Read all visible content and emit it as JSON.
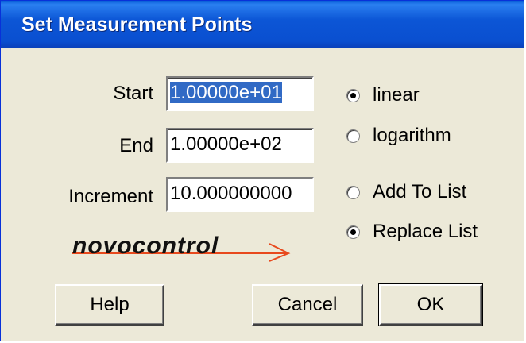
{
  "window": {
    "title": "Set Measurement Points"
  },
  "fields": {
    "start": {
      "label": "Start",
      "value": "1.00000e+01"
    },
    "end": {
      "label": "End",
      "value": "1.00000e+02"
    },
    "increment": {
      "label": "Increment",
      "value": "10.000000000"
    }
  },
  "scale_options": {
    "linear": {
      "label": "linear",
      "selected": true
    },
    "logarithm": {
      "label": "logarithm",
      "selected": false
    }
  },
  "list_options": {
    "add": {
      "label": "Add To List",
      "selected": false
    },
    "replace": {
      "label": "Replace List",
      "selected": true
    }
  },
  "logo": {
    "text": "novocontrol",
    "color": "#e8491d"
  },
  "buttons": {
    "help": "Help",
    "cancel": "Cancel",
    "ok": "OK"
  },
  "colors": {
    "titlebar": "#0a55d5",
    "dialog_bg": "#ece9d8",
    "selection": "#316ac5"
  }
}
